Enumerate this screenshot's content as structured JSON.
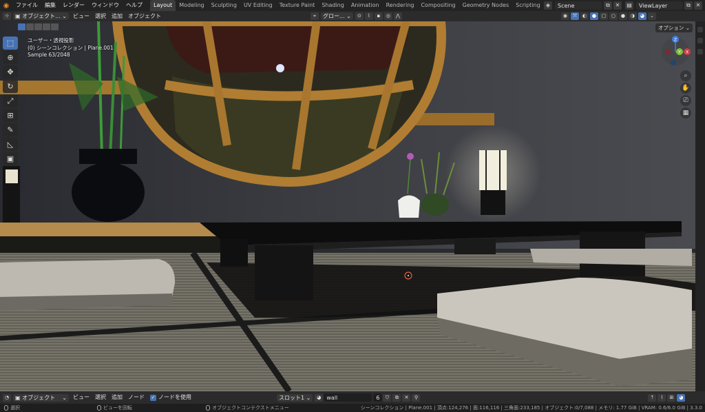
{
  "menubar": {
    "items": [
      "ファイル",
      "編集",
      "レンダー",
      "ウィンドウ",
      "ヘルプ"
    ],
    "workspaces": [
      "Layout",
      "Modeling",
      "Sculpting",
      "UV Editing",
      "Texture Paint",
      "Shading",
      "Animation",
      "Rendering",
      "Compositing",
      "Geometry Nodes",
      "Scripting"
    ],
    "active_workspace": "Layout",
    "add_tab": "+",
    "scene": "Scene",
    "view_layer": "ViewLayer"
  },
  "viewport_header": {
    "mode": "オブジェクト...",
    "menus": [
      "ビュー",
      "選択",
      "追加",
      "オブジェクト"
    ],
    "transform_orientation": "グロー...",
    "options": "オプション"
  },
  "viewport_overlay": {
    "view_name": "ユーザー・透視投影",
    "collection": "(0) シーンコレクション | Plane.001",
    "sample": "Sample 63/2048"
  },
  "gizmo": {
    "z": "Z",
    "y": "Y",
    "x": "X"
  },
  "bottom_header": {
    "mode": "オブジェクト",
    "menus": [
      "ビュー",
      "選択",
      "追加",
      "ノード"
    ],
    "use_nodes_label": "ノードを使用",
    "slot": "スロット1",
    "material": "wall",
    "users": "6"
  },
  "status_bar": {
    "select_hint": "選択",
    "rotate_hint": "ビューを回転",
    "context_hint": "オブジェクトコンテクストメニュー",
    "stats": "シーンコレクション | Plane.001 | 頂点:124,276 | 面:116,116 | 三角面:233,185 | オブジェクト:0/7,088 | メモリ: 1.77 GiB | VRAM: 0.6/6.0 GiB | 3.3.0"
  },
  "colors": {
    "accent": "#4772b3",
    "blender_orange": "#e88b2e",
    "axis_x": "#d13a47",
    "axis_y": "#7fbf3a",
    "axis_z": "#3f7fe0"
  }
}
